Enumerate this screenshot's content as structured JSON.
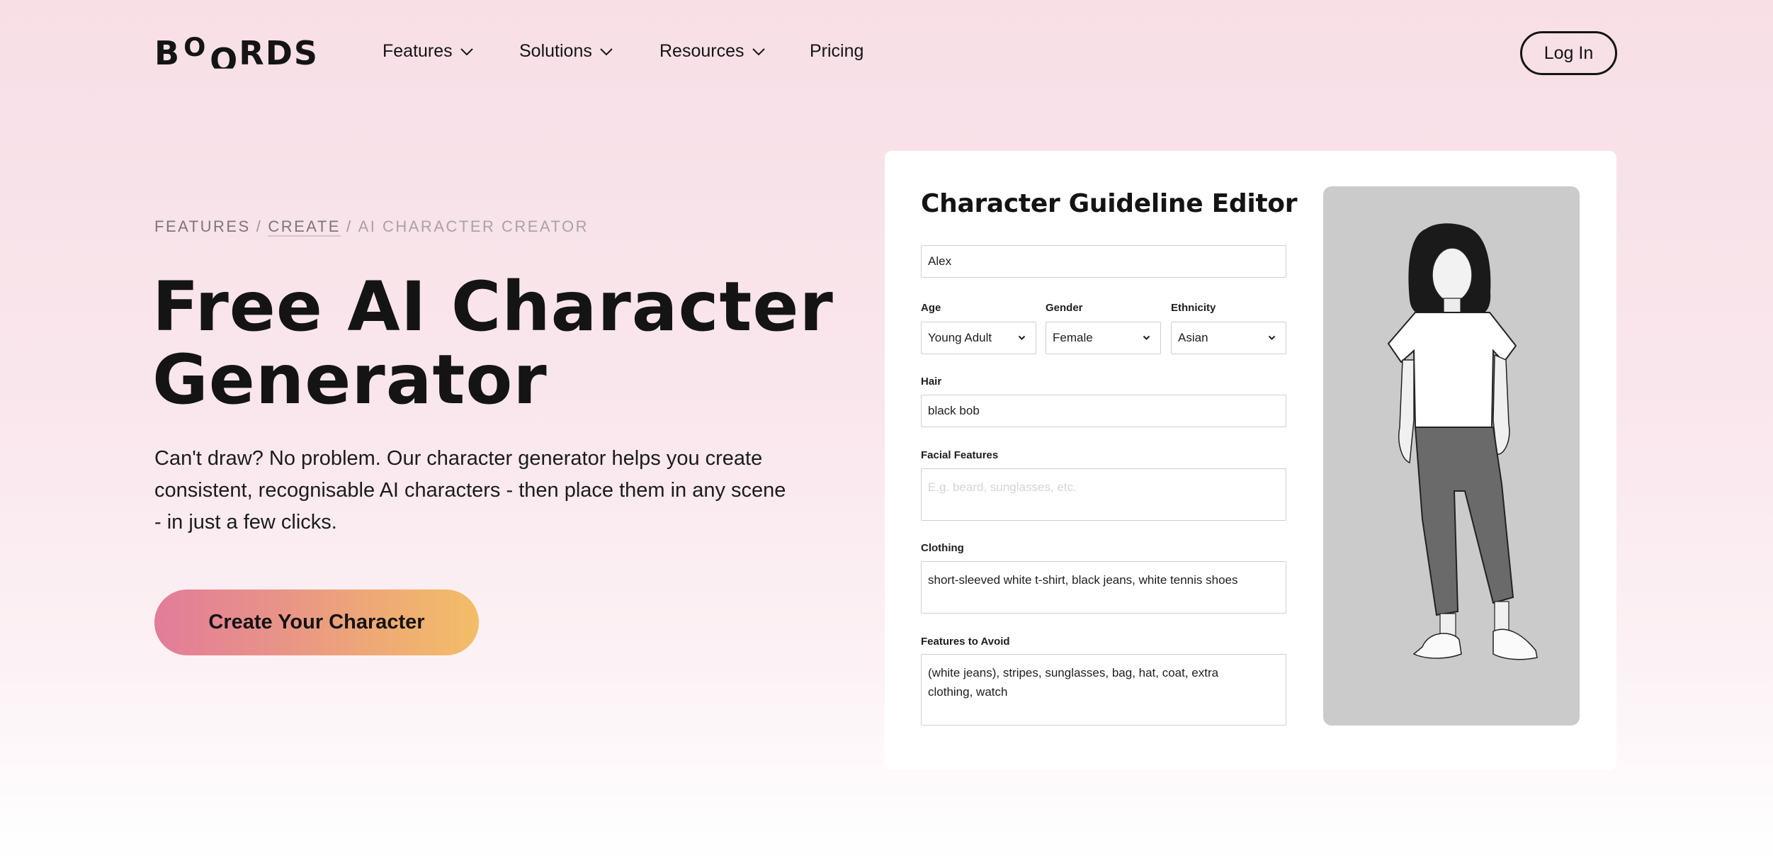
{
  "header": {
    "logo": {
      "letters": [
        "B",
        "O",
        "O",
        "R",
        "D",
        "S"
      ],
      "alt": "Boords"
    },
    "nav": [
      {
        "label": "Features",
        "has_dropdown": true,
        "icon": "chevron-down-icon"
      },
      {
        "label": "Solutions",
        "has_dropdown": true,
        "icon": "chevron-down-icon"
      },
      {
        "label": "Resources",
        "has_dropdown": true,
        "icon": "chevron-down-icon"
      },
      {
        "label": "Pricing",
        "has_dropdown": false
      }
    ],
    "login_label": "Log In"
  },
  "hero": {
    "breadcrumb": [
      {
        "label": "FEATURES",
        "link": false
      },
      {
        "label": "CREATE",
        "link": true
      },
      {
        "label": "AI CHARACTER CREATOR",
        "link": false
      }
    ],
    "breadcrumb_separator": "/",
    "title_line1": "Free AI Character",
    "title_line2": "Generator",
    "description": "Can't draw? No problem. Our character generator helps you create consistent, recognisable AI characters - then place them in any scene - in just a few clicks.",
    "cta_label": "Create Your Character"
  },
  "editor": {
    "title": "Character Guideline Editor",
    "name": {
      "value": "Alex"
    },
    "age": {
      "label": "Age",
      "value": "Young Adult"
    },
    "gender": {
      "label": "Gender",
      "value": "Female"
    },
    "ethnicity": {
      "label": "Ethnicity",
      "value": "Asian"
    },
    "hair": {
      "label": "Hair",
      "value": "black bob"
    },
    "facial_features": {
      "label": "Facial Features",
      "value": "",
      "placeholder": "E.g. beard, sunglasses, etc."
    },
    "clothing": {
      "label": "Clothing",
      "value": "short-sleeved white t-shirt, black jeans, white tennis shoes"
    },
    "features_to_avoid": {
      "label": "Features to Avoid",
      "value": "(white jeans), stripes, sunglasses, bag, hat, coat, extra clothing, watch"
    },
    "preview_image": {
      "description": "Grayscale illustration of a young Asian woman with a black bob, white t-shirt, dark jeans and white sneakers"
    }
  },
  "colors": {
    "cta_gradient_start": "#e27c99",
    "cta_gradient_end": "#f3bd67",
    "background_top": "#f8dfe6",
    "text": "#141414"
  }
}
